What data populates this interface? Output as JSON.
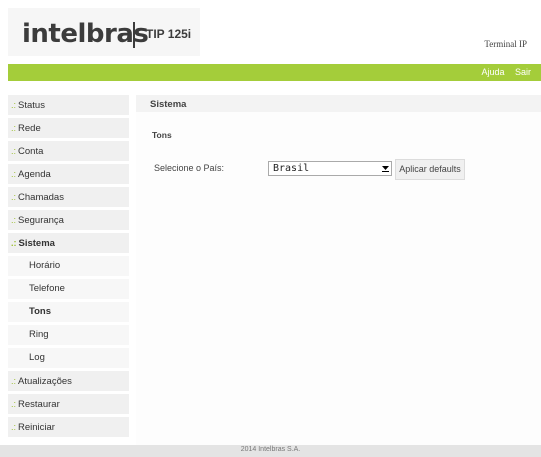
{
  "header": {
    "logo_text": "intelbras",
    "model": "TIP 125i",
    "terminal_label": "Terminal IP"
  },
  "topbar": {
    "help_label": "Ajuda",
    "exit_label": "Sair"
  },
  "sidebar": {
    "bullet": ".:",
    "items": [
      {
        "label": "Status"
      },
      {
        "label": "Rede"
      },
      {
        "label": "Conta"
      },
      {
        "label": "Agenda"
      },
      {
        "label": "Chamadas"
      },
      {
        "label": "Segurança"
      },
      {
        "label": "Sistema",
        "active": true
      },
      {
        "label": "Atualizações"
      },
      {
        "label": "Restaurar"
      },
      {
        "label": "Reiniciar"
      }
    ],
    "subitems": [
      {
        "label": "Horário"
      },
      {
        "label": "Telefone"
      },
      {
        "label": "Tons",
        "active": true
      },
      {
        "label": "Ring"
      },
      {
        "label": "Log"
      }
    ]
  },
  "main": {
    "section_title": "Sistema",
    "sub_title": "Tons",
    "country_label": "Selecione o País:",
    "country_value": "Brasil",
    "apply_label": "Aplicar defaults"
  },
  "footer": {
    "text": "2014 Intelbras S.A."
  },
  "colors": {
    "accent": "#a4cd3a",
    "bullet": "#9bbf2f"
  }
}
